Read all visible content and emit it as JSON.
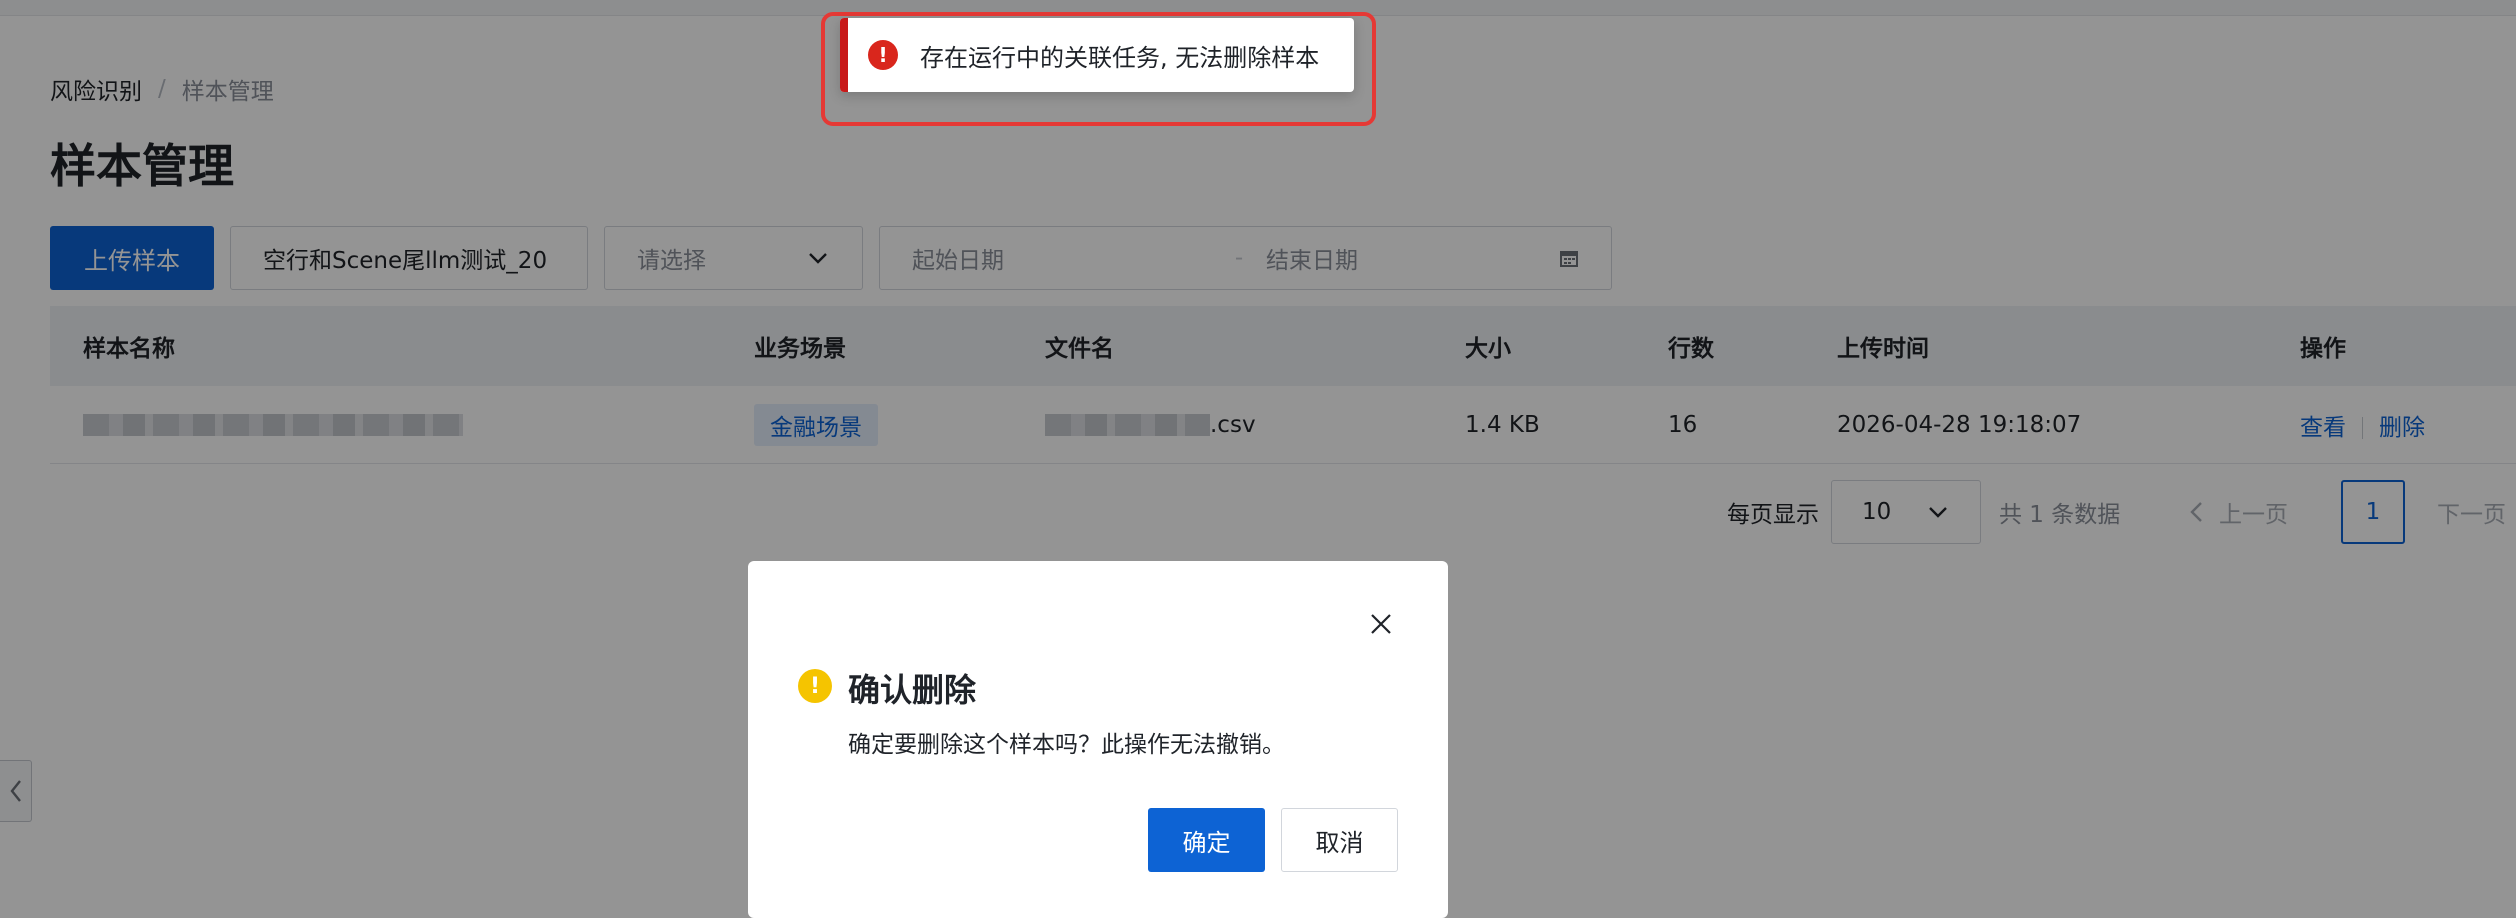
{
  "breadcrumb": {
    "root": "风险识别",
    "separator": "/",
    "current": "样本管理"
  },
  "page_title": "样本管理",
  "toolbar": {
    "upload_label": "上传样本",
    "search_value": "空行和Scene尾llm测试_20",
    "scene_select_placeholder": "请选择",
    "date_start_placeholder": "起始日期",
    "date_separator": "-",
    "date_end_placeholder": "结束日期"
  },
  "table": {
    "columns": [
      "样本名称",
      "业务场景",
      "文件名",
      "大小",
      "行数",
      "上传时间",
      "操作"
    ],
    "rows": [
      {
        "scene": "金融场景",
        "file_suffix": ".csv",
        "size": "1.4 KB",
        "rows": "16",
        "upload_time": "2026-04-28 19:18:07",
        "action_view": "查看",
        "action_delete": "删除"
      }
    ]
  },
  "pagination": {
    "page_size_label": "每页显示",
    "page_size": "10",
    "total": "共 1 条数据",
    "prev": "上一页",
    "current": "1",
    "next": "下一页"
  },
  "toast": {
    "message": "存在运行中的关联任务, 无法删除样本",
    "icon": "error-icon"
  },
  "modal": {
    "title": "确认删除",
    "body": "确定要删除这个样本吗？此操作无法撤销。",
    "confirm": "确定",
    "cancel": "取消",
    "icon": "warning-icon"
  },
  "colors": {
    "primary": "#0d63d4",
    "error": "#d9261c",
    "warning": "#f5c400",
    "highlight": "#e53935"
  }
}
